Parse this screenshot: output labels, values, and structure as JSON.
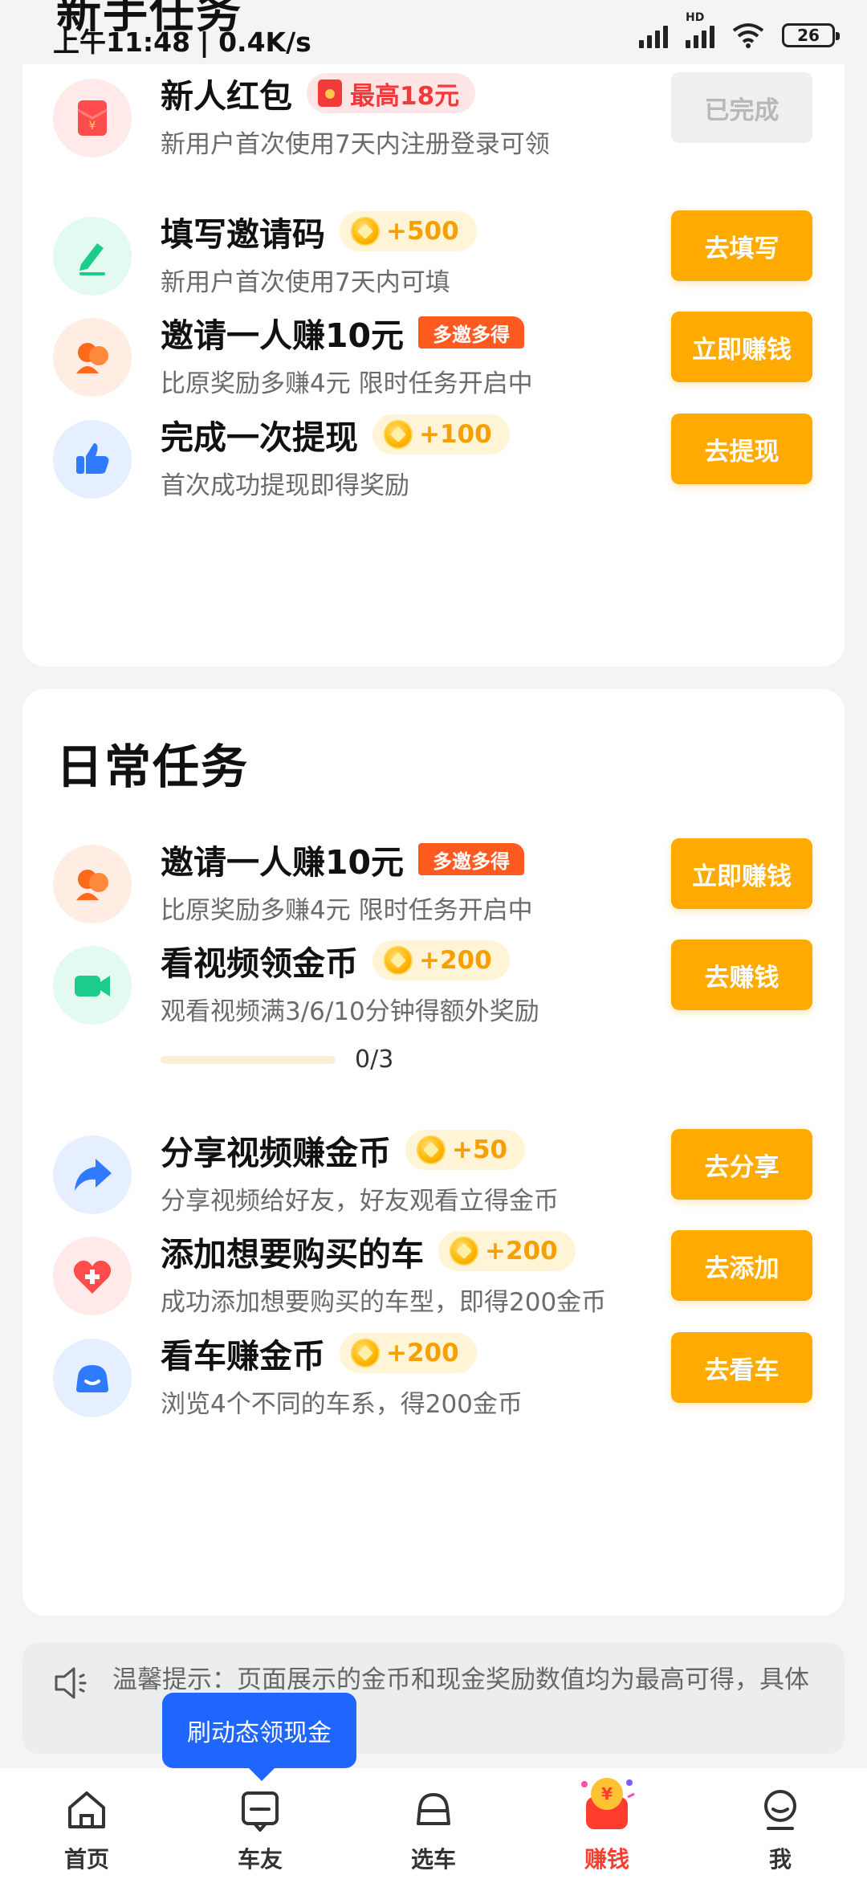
{
  "status_bar": {
    "peek_title": "新手任务",
    "time": "上午11:48 | 0.4K/s",
    "hd": "HD",
    "battery": "26"
  },
  "newbie": {
    "tasks": [
      {
        "title": "新人红包",
        "badge_type": "red",
        "badge": "最高18元",
        "desc": "新用户首次使用7天内注册登录可领",
        "button": "已完成",
        "done": true,
        "icon": "red-envelope-icon",
        "color": "#FF4D4D"
      },
      {
        "title": "填写邀请码",
        "badge_type": "coin",
        "badge": "+500",
        "desc": "新用户首次使用7天内可填",
        "button": "去填写",
        "icon": "pencil-icon",
        "color": "#1DCB8B"
      },
      {
        "title": "邀请一人赚10元",
        "badge_type": "tag",
        "badge": "多邀多得",
        "desc": "比原奖励多赚4元 限时任务开启中",
        "button": "立即赚钱",
        "icon": "invite-people-icon",
        "color": "#FF6A1A"
      },
      {
        "title": "完成一次提现",
        "badge_type": "coin",
        "badge": "+100",
        "desc": "首次成功提现即得奖励",
        "button": "去提现",
        "icon": "thumbs-up-icon",
        "color": "#2F7BFF"
      }
    ]
  },
  "daily": {
    "title": "日常任务",
    "tasks": [
      {
        "title": "邀请一人赚10元",
        "badge_type": "tag",
        "badge": "多邀多得",
        "desc": "比原奖励多赚4元 限时任务开启中",
        "button": "立即赚钱",
        "icon": "invite-people-icon",
        "color": "#FF6A1A"
      },
      {
        "title": "看视频领金币",
        "badge_type": "coin",
        "badge": "+200",
        "desc": "观看视频满3/6/10分钟得额外奖励",
        "button": "去赚钱",
        "icon": "video-camera-icon",
        "color": "#1DCB8B",
        "progress": "0/3"
      },
      {
        "title": "分享视频赚金币",
        "badge_type": "coin",
        "badge": "+50",
        "desc": "分享视频给好友，好友观看立得金币",
        "button": "去分享",
        "icon": "share-arrow-icon",
        "color": "#2F7BFF"
      },
      {
        "title": "添加想要购买的车",
        "badge_type": "coin",
        "badge": "+200",
        "desc": "成功添加想要购买的车型，即得200金币",
        "button": "去添加",
        "icon": "heart-plus-icon",
        "color": "#FF4D4D"
      },
      {
        "title": "看车赚金币",
        "badge_type": "coin",
        "badge": "+200",
        "desc": "浏览4个不同的车系，得200金币",
        "button": "去看车",
        "icon": "car-face-icon",
        "color": "#2F7BFF"
      }
    ]
  },
  "tip": {
    "text": "温馨提示：页面展示的金币和现金奖励数值均为最高可得，具体"
  },
  "tooltip": "刷动态领现金",
  "nav": [
    {
      "label": "首页",
      "icon": "home-icon"
    },
    {
      "label": "车友",
      "icon": "chat-icon"
    },
    {
      "label": "选车",
      "icon": "car-icon"
    },
    {
      "label": "赚钱",
      "icon": "earn-money-icon",
      "active": true
    },
    {
      "label": "我",
      "icon": "profile-icon"
    }
  ]
}
